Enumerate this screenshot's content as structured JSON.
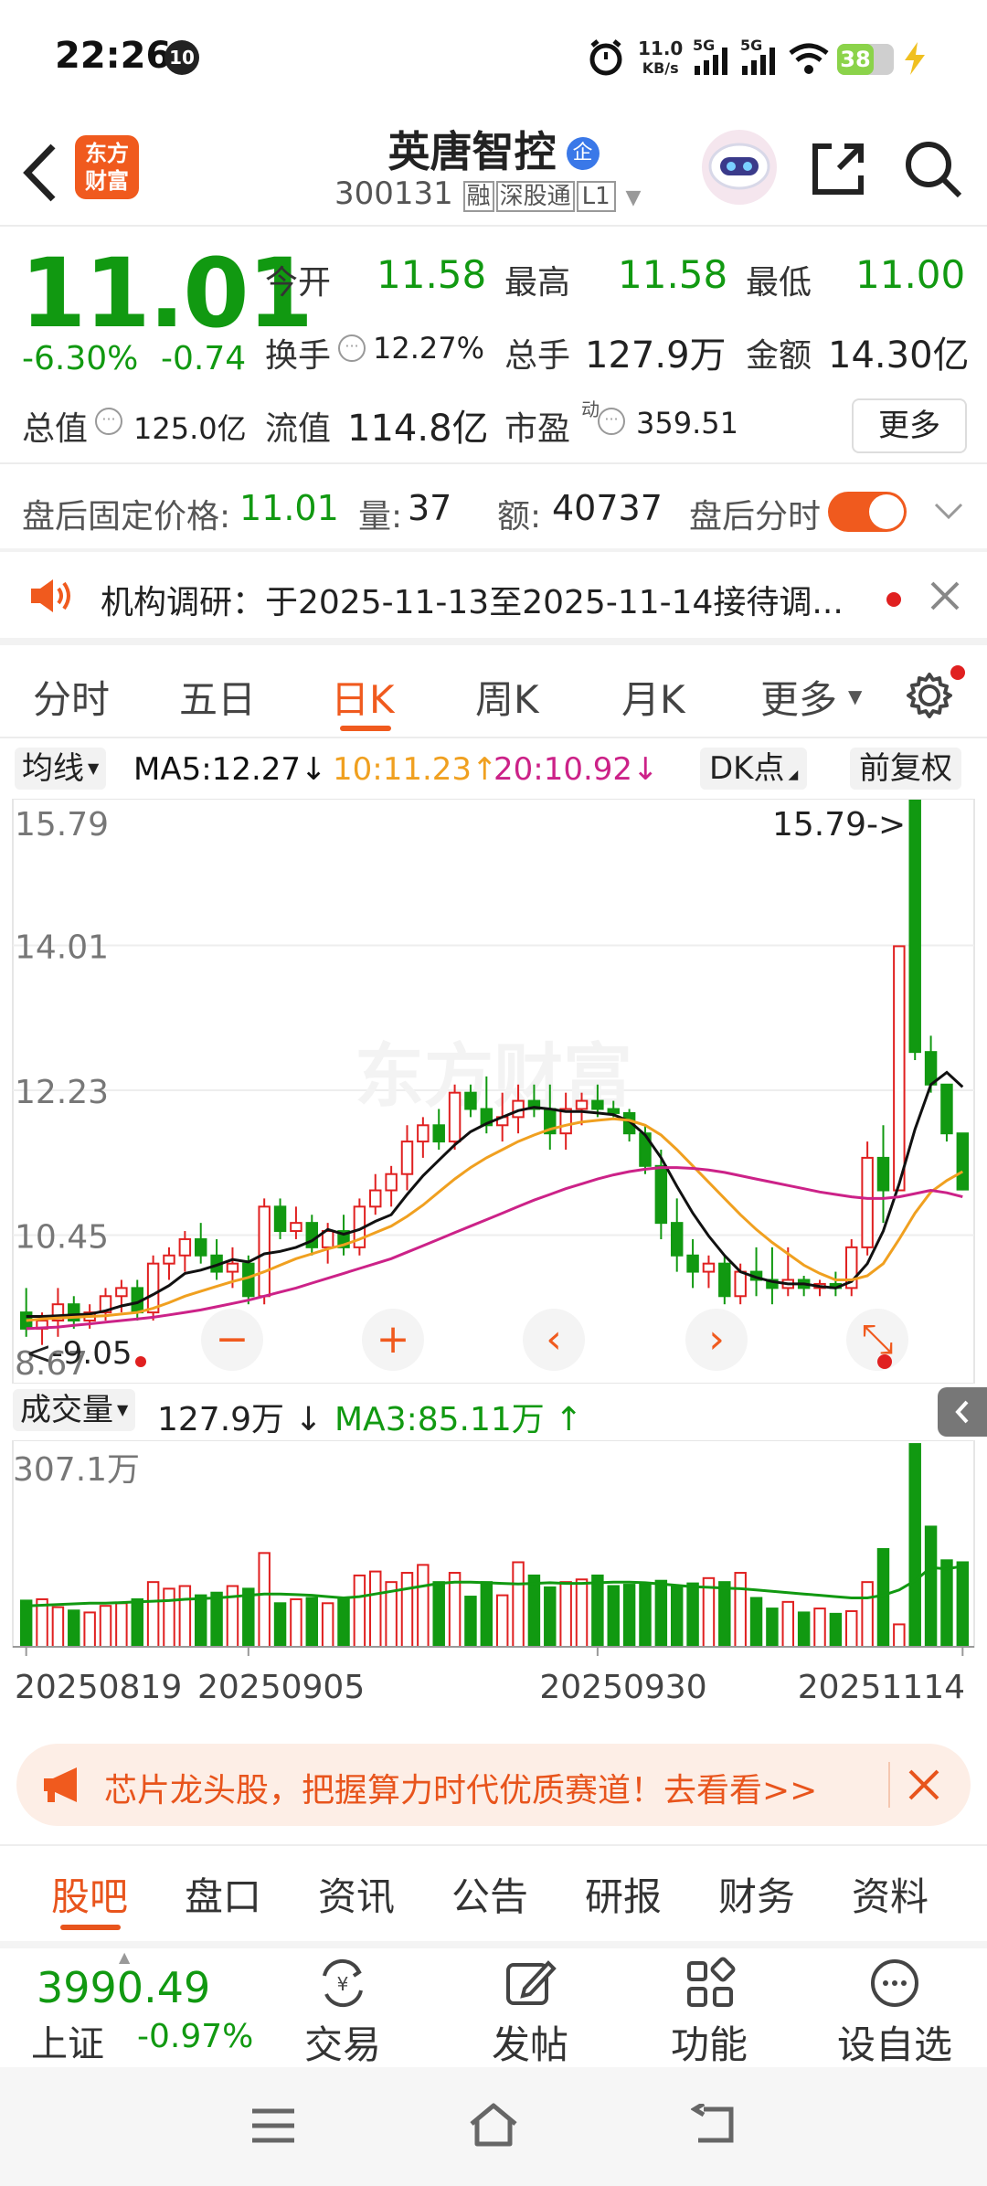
{
  "status_bar": {
    "time": "22:26",
    "notif_badge": "10",
    "net_speed_top": "11.0",
    "net_speed_unit": "KB/s",
    "sig1": "5G",
    "sig2": "5G",
    "battery": "38"
  },
  "header": {
    "logo_line1": "东方",
    "logo_line2": "财富",
    "stock_name": "英唐智控",
    "name_badge": "企",
    "code": "300131",
    "tag_rong": "融",
    "tag_sgt": "深股通",
    "tag_level": "L1"
  },
  "quote": {
    "price": "11.01",
    "change_pct": "-6.30%",
    "change": "-0.74",
    "open_label": "今开",
    "open": "11.58",
    "high_label": "最高",
    "high": "11.58",
    "low_label": "最低",
    "low": "11.00",
    "turnover_label": "换手",
    "turnover": "12.27%",
    "volume_label": "总手",
    "volume": "127.9万",
    "amount_label": "金额",
    "amount": "14.30亿",
    "mktcap_label": "总值",
    "mktcap": "125.0亿",
    "float_label": "流值",
    "float": "114.8亿",
    "pe_label": "市盈",
    "pe_sup": "动",
    "pe": "359.51",
    "more": "更多"
  },
  "after_hours": {
    "label": "盘后固定价格:",
    "price": "11.01",
    "vol_label": "量:",
    "vol": "37",
    "amt_label": "额:",
    "amt": "40737",
    "toggle_label": "盘后分时"
  },
  "notice": {
    "text": "机构调研：于2025-11-13至2025-11-14接待调..."
  },
  "tabs": [
    "分时",
    "五日",
    "日K",
    "周K",
    "月K",
    "更多"
  ],
  "active_tab": "日K",
  "ma_bar": {
    "label": "均线",
    "ma5": "MA5:12.27",
    "ma10": "10:11.23",
    "ma20": "20:10.92",
    "dk": "DK点",
    "fq": "前复权"
  },
  "vol_bar": {
    "label": "成交量",
    "value": "127.9万",
    "ma3": "MA3:85.11万"
  },
  "chart_data": {
    "type": "candlestick",
    "price_ticks": [
      "15.79",
      "14.01",
      "12.23",
      "10.45",
      "8.67"
    ],
    "max_label": "15.79->",
    "min_label": "<-9.05",
    "volume_max_label": "307.1万",
    "date_ticks": [
      "20250819",
      "20250905",
      "20250930",
      "20251114"
    ],
    "ylim": [
      8.67,
      15.79
    ],
    "colors": {
      "up": "#e02020",
      "down": "#119911",
      "ma5": "#111111",
      "ma10": "#f0a020",
      "ma20": "#cc2288"
    },
    "candles": [
      {
        "o": 9.5,
        "h": 9.8,
        "l": 9.2,
        "c": 9.3,
        "v": 70
      },
      {
        "o": 9.3,
        "h": 9.5,
        "l": 9.1,
        "c": 9.4,
        "v": 72
      },
      {
        "o": 9.4,
        "h": 9.8,
        "l": 9.2,
        "c": 9.6,
        "v": 60
      },
      {
        "o": 9.6,
        "h": 9.7,
        "l": 9.3,
        "c": 9.4,
        "v": 55
      },
      {
        "o": 9.4,
        "h": 9.6,
        "l": 9.3,
        "c": 9.5,
        "v": 52
      },
      {
        "o": 9.5,
        "h": 9.8,
        "l": 9.4,
        "c": 9.7,
        "v": 62
      },
      {
        "o": 9.7,
        "h": 9.9,
        "l": 9.5,
        "c": 9.8,
        "v": 66
      },
      {
        "o": 9.8,
        "h": 9.9,
        "l": 9.4,
        "c": 9.5,
        "v": 72
      },
      {
        "o": 9.5,
        "h": 10.2,
        "l": 9.4,
        "c": 10.1,
        "v": 98
      },
      {
        "o": 10.1,
        "h": 10.3,
        "l": 9.9,
        "c": 10.2,
        "v": 88
      },
      {
        "o": 10.2,
        "h": 10.5,
        "l": 10.0,
        "c": 10.4,
        "v": 92
      },
      {
        "o": 10.4,
        "h": 10.6,
        "l": 10.1,
        "c": 10.2,
        "v": 78
      },
      {
        "o": 10.2,
        "h": 10.4,
        "l": 9.9,
        "c": 10.0,
        "v": 82
      },
      {
        "o": 10.0,
        "h": 10.3,
        "l": 9.8,
        "c": 10.1,
        "v": 92
      },
      {
        "o": 10.1,
        "h": 10.2,
        "l": 9.6,
        "c": 9.7,
        "v": 88
      },
      {
        "o": 9.7,
        "h": 10.9,
        "l": 9.6,
        "c": 10.8,
        "v": 142
      },
      {
        "o": 10.8,
        "h": 10.9,
        "l": 10.4,
        "c": 10.5,
        "v": 66
      },
      {
        "o": 10.5,
        "h": 10.8,
        "l": 10.4,
        "c": 10.6,
        "v": 72
      },
      {
        "o": 10.6,
        "h": 10.7,
        "l": 10.2,
        "c": 10.3,
        "v": 74
      },
      {
        "o": 10.3,
        "h": 10.6,
        "l": 10.1,
        "c": 10.5,
        "v": 66
      },
      {
        "o": 10.5,
        "h": 10.7,
        "l": 10.2,
        "c": 10.3,
        "v": 72
      },
      {
        "o": 10.3,
        "h": 10.9,
        "l": 10.2,
        "c": 10.8,
        "v": 108
      },
      {
        "o": 10.8,
        "h": 11.2,
        "l": 10.7,
        "c": 11.0,
        "v": 114
      },
      {
        "o": 11.0,
        "h": 11.3,
        "l": 10.8,
        "c": 11.2,
        "v": 98
      },
      {
        "o": 11.2,
        "h": 11.8,
        "l": 11.0,
        "c": 11.6,
        "v": 112
      },
      {
        "o": 11.6,
        "h": 11.9,
        "l": 11.4,
        "c": 11.8,
        "v": 124
      },
      {
        "o": 11.8,
        "h": 12.0,
        "l": 11.5,
        "c": 11.6,
        "v": 98
      },
      {
        "o": 11.6,
        "h": 12.3,
        "l": 11.5,
        "c": 12.2,
        "v": 112
      },
      {
        "o": 12.2,
        "h": 12.3,
        "l": 11.9,
        "c": 12.0,
        "v": 76
      },
      {
        "o": 12.0,
        "h": 12.4,
        "l": 11.7,
        "c": 11.8,
        "v": 98
      },
      {
        "o": 11.8,
        "h": 12.2,
        "l": 11.6,
        "c": 11.9,
        "v": 78
      },
      {
        "o": 11.9,
        "h": 12.3,
        "l": 11.7,
        "c": 12.1,
        "v": 128
      },
      {
        "o": 12.1,
        "h": 12.3,
        "l": 11.9,
        "c": 12.0,
        "v": 108
      },
      {
        "o": 12.0,
        "h": 12.3,
        "l": 11.5,
        "c": 11.7,
        "v": 90
      },
      {
        "o": 11.7,
        "h": 12.2,
        "l": 11.5,
        "c": 12.0,
        "v": 98
      },
      {
        "o": 12.0,
        "h": 12.2,
        "l": 11.8,
        "c": 12.1,
        "v": 102
      },
      {
        "o": 12.1,
        "h": 12.3,
        "l": 11.9,
        "c": 12.0,
        "v": 108
      },
      {
        "o": 12.0,
        "h": 12.1,
        "l": 11.9,
        "c": 11.95,
        "v": 92
      },
      {
        "o": 11.95,
        "h": 12.0,
        "l": 11.6,
        "c": 11.7,
        "v": 94
      },
      {
        "o": 11.7,
        "h": 11.8,
        "l": 11.2,
        "c": 11.3,
        "v": 96
      },
      {
        "o": 11.3,
        "h": 11.5,
        "l": 10.4,
        "c": 10.6,
        "v": 100
      },
      {
        "o": 10.6,
        "h": 10.9,
        "l": 10.0,
        "c": 10.2,
        "v": 92
      },
      {
        "o": 10.2,
        "h": 10.4,
        "l": 9.8,
        "c": 10.0,
        "v": 96
      },
      {
        "o": 10.0,
        "h": 10.2,
        "l": 9.8,
        "c": 10.1,
        "v": 104
      },
      {
        "o": 10.1,
        "h": 10.2,
        "l": 9.6,
        "c": 9.7,
        "v": 98
      },
      {
        "o": 9.7,
        "h": 10.1,
        "l": 9.6,
        "c": 10.0,
        "v": 112
      },
      {
        "o": 10.0,
        "h": 10.3,
        "l": 9.7,
        "c": 9.9,
        "v": 74
      },
      {
        "o": 9.9,
        "h": 10.3,
        "l": 9.6,
        "c": 9.8,
        "v": 58
      },
      {
        "o": 9.8,
        "h": 10.3,
        "l": 9.7,
        "c": 9.9,
        "v": 68
      },
      {
        "o": 9.9,
        "h": 9.95,
        "l": 9.7,
        "c": 9.8,
        "v": 52
      },
      {
        "o": 9.8,
        "h": 9.9,
        "l": 9.7,
        "c": 9.85,
        "v": 58
      },
      {
        "o": 9.85,
        "h": 10.0,
        "l": 9.7,
        "c": 9.8,
        "v": 50
      },
      {
        "o": 9.8,
        "h": 10.4,
        "l": 9.7,
        "c": 10.3,
        "v": 54
      },
      {
        "o": 10.3,
        "h": 11.6,
        "l": 10.2,
        "c": 11.4,
        "v": 98
      },
      {
        "o": 11.4,
        "h": 11.8,
        "l": 10.6,
        "c": 11.0,
        "v": 148
      },
      {
        "o": 11.0,
        "h": 14.0,
        "l": 11.0,
        "c": 14.0,
        "v": 34
      },
      {
        "o": 15.79,
        "h": 15.79,
        "l": 12.6,
        "c": 12.7,
        "v": 307
      },
      {
        "o": 12.7,
        "h": 12.9,
        "l": 12.2,
        "c": 12.3,
        "v": 182
      },
      {
        "o": 12.3,
        "h": 12.3,
        "l": 11.6,
        "c": 11.7,
        "v": 131
      },
      {
        "o": 11.7,
        "h": 11.7,
        "l": 11.0,
        "c": 11.01,
        "v": 128
      }
    ],
    "ma5": [
      9.45,
      9.45,
      9.46,
      9.47,
      9.48,
      9.52,
      9.58,
      9.62,
      9.72,
      9.83,
      9.98,
      10.02,
      10.08,
      10.15,
      10.12,
      10.22,
      10.25,
      10.3,
      10.38,
      10.52,
      10.46,
      10.52,
      10.62,
      10.7,
      10.95,
      11.18,
      11.37,
      11.56,
      11.72,
      11.82,
      11.9,
      11.98,
      12.02,
      12.0,
      11.97,
      11.97,
      11.95,
      11.93,
      11.85,
      11.68,
      11.4,
      11.05,
      10.72,
      10.44,
      10.2,
      10.0,
      9.93,
      9.88,
      9.85,
      9.85,
      9.82,
      9.8,
      9.88,
      10.1,
      10.5,
      11.08,
      11.75,
      12.3,
      12.45,
      12.27
    ],
    "ma10": [
      9.4,
      9.42,
      9.43,
      9.44,
      9.45,
      9.46,
      9.48,
      9.5,
      9.55,
      9.62,
      9.7,
      9.76,
      9.82,
      9.88,
      9.93,
      10.0,
      10.08,
      10.16,
      10.22,
      10.28,
      10.33,
      10.4,
      10.48,
      10.56,
      10.68,
      10.82,
      10.98,
      11.14,
      11.28,
      11.4,
      11.5,
      11.6,
      11.68,
      11.75,
      11.8,
      11.84,
      11.86,
      11.88,
      11.86,
      11.8,
      11.68,
      11.5,
      11.3,
      11.1,
      10.9,
      10.7,
      10.52,
      10.36,
      10.22,
      10.08,
      9.98,
      9.9,
      9.9,
      9.95,
      10.1,
      10.4,
      10.72,
      10.98,
      11.12,
      11.23
    ],
    "ma20": [
      9.3,
      9.31,
      9.32,
      9.34,
      9.36,
      9.38,
      9.4,
      9.42,
      9.44,
      9.47,
      9.5,
      9.53,
      9.57,
      9.61,
      9.65,
      9.7,
      9.75,
      9.8,
      9.86,
      9.92,
      9.98,
      10.04,
      10.1,
      10.16,
      10.24,
      10.32,
      10.4,
      10.48,
      10.56,
      10.64,
      10.72,
      10.8,
      10.88,
      10.95,
      11.02,
      11.08,
      11.14,
      11.19,
      11.23,
      11.26,
      11.28,
      11.28,
      11.27,
      11.25,
      11.22,
      11.18,
      11.14,
      11.1,
      11.06,
      11.02,
      10.98,
      10.95,
      10.92,
      10.9,
      10.9,
      10.92,
      10.96,
      11.0,
      10.97,
      10.92
    ],
    "vol_ma3": [
      62,
      63,
      64,
      65,
      66,
      66,
      67,
      68,
      69,
      70,
      72,
      73,
      74,
      76,
      78,
      80,
      80,
      79,
      78,
      76,
      74,
      76,
      80,
      84,
      88,
      92,
      96,
      98,
      98,
      97,
      96,
      95,
      96,
      97,
      96,
      96,
      97,
      98,
      98,
      97,
      95,
      93,
      91,
      90,
      89,
      88,
      86,
      84,
      82,
      80,
      78,
      76,
      74,
      74,
      78,
      86,
      100,
      120,
      118,
      122
    ]
  },
  "sub_tabs": [
    "股吧",
    "盘口",
    "资讯",
    "公告",
    "研报",
    "财务",
    "资料"
  ],
  "active_sub_tab": "股吧",
  "ad_text": "芯片龙头股，把握算力时代优质赛道！去看看>>",
  "index": {
    "value": "3990.49",
    "name": "上证",
    "change": "-0.97%"
  },
  "bottom_nav": [
    "交易",
    "发帖",
    "功能",
    "设自选"
  ]
}
